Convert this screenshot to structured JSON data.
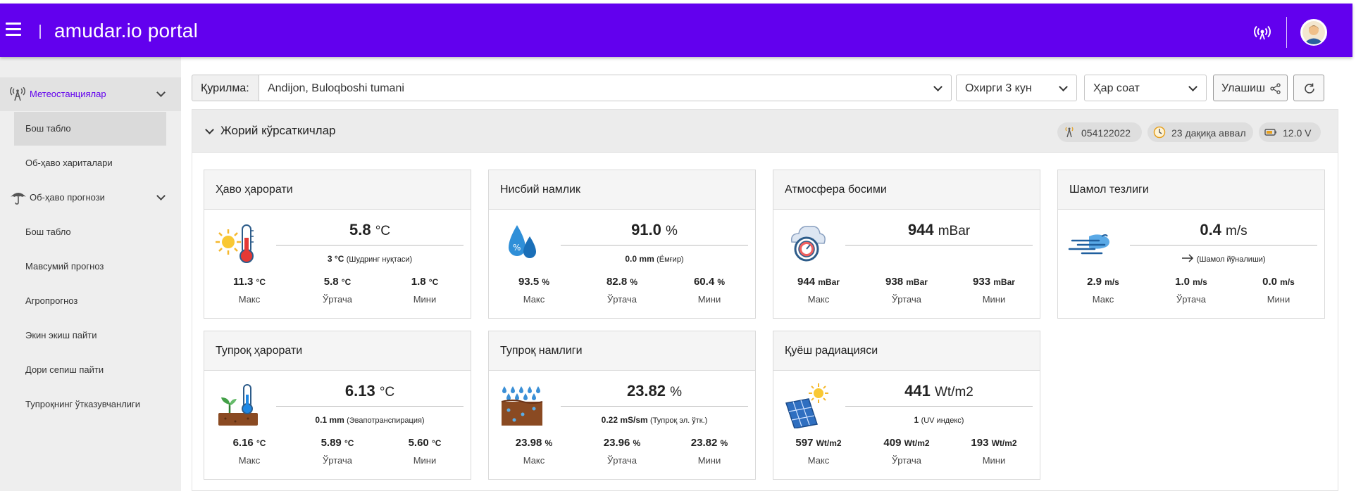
{
  "header": {
    "title": "amudar.io portal"
  },
  "sidebar": {
    "items": [
      {
        "label": "Метеостанциялар"
      },
      {
        "label": "Бош табло"
      },
      {
        "label": "Об-ҳаво хариталари"
      },
      {
        "label": "Об-ҳаво прогнози"
      },
      {
        "label": "Бош табло"
      },
      {
        "label": "Мавсумий прогноз"
      },
      {
        "label": "Агропрогноз"
      },
      {
        "label": "Экин экиш пайти"
      },
      {
        "label": "Дори сепиш пайти"
      },
      {
        "label": "Тупроқнинг ўтказувчанлиги"
      }
    ]
  },
  "filters": {
    "device_label": "Қурилма:",
    "device_value": "Andijon, Buloqboshi tumani",
    "period_value": "Охирги 3 кун",
    "interval_value": "Ҳар соат",
    "share_label": "Улашиш"
  },
  "panel": {
    "title": "Жорий кўрсаткичлар",
    "chips": {
      "station_id": "054122022",
      "last_update": "23 дақиқа аввал",
      "battery": "12.0 V"
    }
  },
  "cards": {
    "air_temp": {
      "title": "Ҳаво ҳарорати",
      "value": "5.8",
      "unit": "°C",
      "sub_value": "3",
      "sub_unit": "°C",
      "sub_note": "(Шудринг нуқтаси)",
      "max": "11.3",
      "avg": "5.8",
      "min": "1.8",
      "stat_unit": "°C"
    },
    "humidity": {
      "title": "Нисбий намлик",
      "value": "91.0",
      "unit": "%",
      "sub_value": "0.0",
      "sub_unit": "mm",
      "sub_note": "(Ёмғир)",
      "max": "93.5",
      "avg": "82.8",
      "min": "60.4",
      "stat_unit": "%"
    },
    "pressure": {
      "title": "Атмосфера босими",
      "value": "944",
      "unit": "mBar",
      "max": "944",
      "avg": "938",
      "min": "933",
      "stat_unit": "mBar"
    },
    "wind": {
      "title": "Шамол тезлиги",
      "value": "0.4",
      "unit": "m/s",
      "sub_note": "(Шамол йўналиши)",
      "max": "2.9",
      "avg": "1.0",
      "min": "0.0",
      "stat_unit": "m/s"
    },
    "soil_temp": {
      "title": "Тупроқ ҳарорати",
      "value": "6.13",
      "unit": "°C",
      "sub_value": "0.1",
      "sub_unit": "mm",
      "sub_note": "(Эвапотранспирация)",
      "max": "6.16",
      "avg": "5.89",
      "min": "5.60",
      "stat_unit": "°C"
    },
    "soil_moisture": {
      "title": "Тупроқ намлиги",
      "value": "23.82",
      "unit": "%",
      "sub_value": "0.22",
      "sub_unit": "mS/sm",
      "sub_note": "(Тупроқ эл. ўтк.)",
      "max": "23.98",
      "avg": "23.96",
      "min": "23.82",
      "stat_unit": "%"
    },
    "solar": {
      "title": "Қуёш радиацияси",
      "value": "441",
      "unit": "Wt/m2",
      "sub_value": "1",
      "sub_note": "(UV индекс)",
      "max": "597",
      "avg": "409",
      "min": "193",
      "stat_unit": "Wt/m2"
    }
  },
  "stat_labels": {
    "max": "Макс",
    "avg": "Ўртача",
    "min": "Мини"
  },
  "colors": {
    "primary": "#6200ee",
    "sidebar_bg": "#eeeeee",
    "active_link": "#6200ee"
  },
  "icons": {
    "menu": "hamburger-icon",
    "antenna": "wireless-signal-icon",
    "avatar": "user-avatar-icon",
    "station": "radio-tower-icon",
    "forecast": "umbrella-icon",
    "share": "share-icon",
    "refresh": "refresh-icon",
    "clock": "clock-icon",
    "battery": "battery-icon"
  }
}
